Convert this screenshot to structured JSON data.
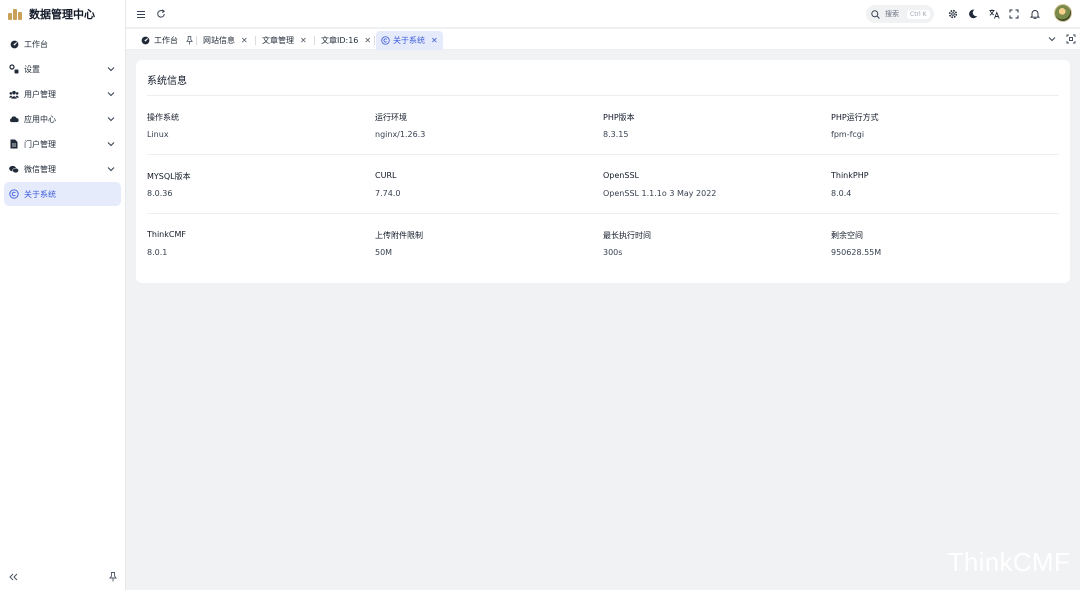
{
  "app": {
    "title": "数据管理中心"
  },
  "sidebar": {
    "items": [
      {
        "label": "工作台",
        "icon": "dashboard-icon",
        "has_children": false,
        "active": false
      },
      {
        "label": "设置",
        "icon": "settings-icon",
        "has_children": true,
        "active": false
      },
      {
        "label": "用户管理",
        "icon": "users-icon",
        "has_children": true,
        "active": false
      },
      {
        "label": "应用中心",
        "icon": "cloud-icon",
        "has_children": true,
        "active": false
      },
      {
        "label": "门户管理",
        "icon": "document-icon",
        "has_children": true,
        "active": false
      },
      {
        "label": "微信管理",
        "icon": "wechat-icon",
        "has_children": true,
        "active": false
      },
      {
        "label": "关于系统",
        "icon": "copyright-icon",
        "has_children": false,
        "active": true
      }
    ]
  },
  "header": {
    "search_label": "搜索",
    "search_shortcut": "Ctrl K"
  },
  "tabs": [
    {
      "label": "工作台",
      "pinned": true,
      "active": false
    },
    {
      "label": "网站信息",
      "pinned": false,
      "active": false
    },
    {
      "label": "文章管理",
      "pinned": false,
      "active": false
    },
    {
      "label": "文章ID:16",
      "pinned": false,
      "active": false
    },
    {
      "label": "关于系统",
      "pinned": false,
      "active": true
    }
  ],
  "system_info": {
    "title": "系统信息",
    "rows": [
      [
        {
          "key": "操作系统",
          "value": "Linux"
        },
        {
          "key": "运行环境",
          "value": "nginx/1.26.3"
        },
        {
          "key": "PHP版本",
          "value": "8.3.15"
        },
        {
          "key": "PHP运行方式",
          "value": "fpm-fcgi"
        }
      ],
      [
        {
          "key": "MYSQL版本",
          "value": "8.0.36"
        },
        {
          "key": "CURL",
          "value": "7.74.0"
        },
        {
          "key": "OpenSSL",
          "value": "OpenSSL 1.1.1o 3 May 2022"
        },
        {
          "key": "ThinkPHP",
          "value": "8.0.4"
        }
      ],
      [
        {
          "key": "ThinkCMF",
          "value": "8.0.1"
        },
        {
          "key": "上传附件限制",
          "value": "50M"
        },
        {
          "key": "最长执行时间",
          "value": "300s"
        },
        {
          "key": "剩余空间",
          "value": "950628.55M"
        }
      ]
    ]
  },
  "watermark": "ThinkCMF",
  "colors": {
    "accent": "#3b5bdb",
    "active_bg": "#e6ebfb",
    "page_bg": "#f1f2f4"
  }
}
